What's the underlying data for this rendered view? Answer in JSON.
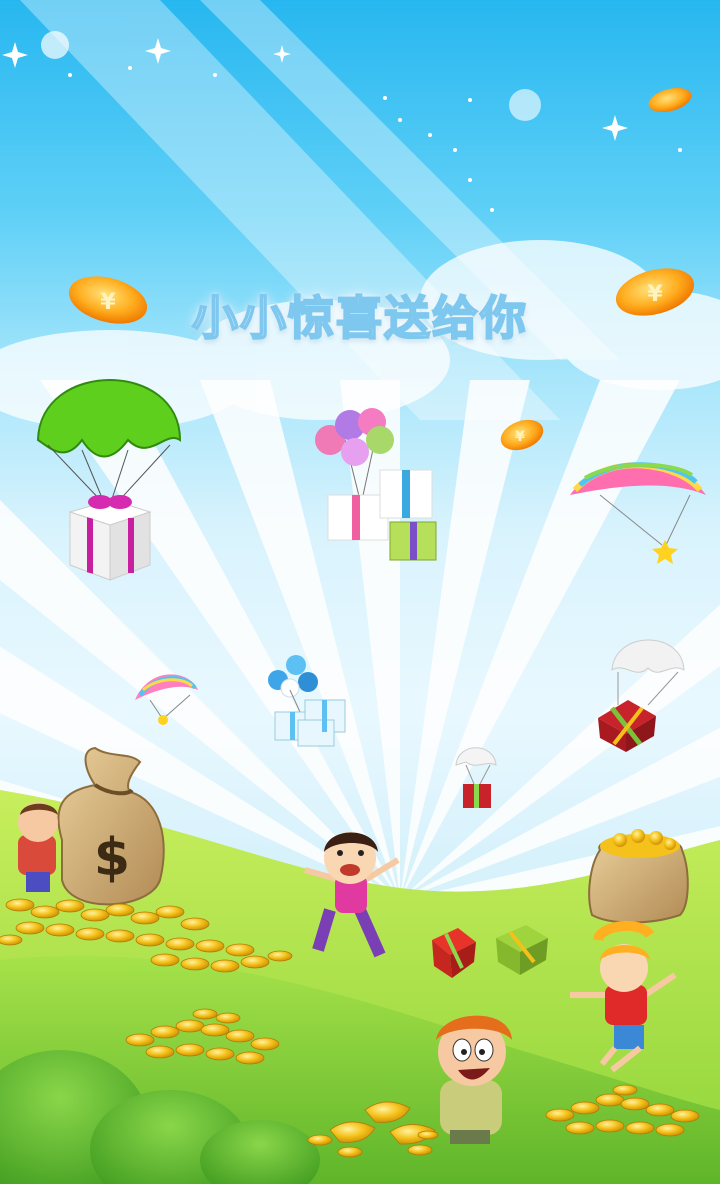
{
  "banner": {
    "title": "小小惊喜送给你"
  },
  "icons": {
    "coin": "yen-coin-icon",
    "money_bag": "dollar-money-bag-icon",
    "gift": "gift-box-icon",
    "parachute": "parachute-icon",
    "balloon": "balloon-icon"
  },
  "money_bag": {
    "symbol": "$"
  },
  "coin_symbol": "¥",
  "colors": {
    "sky_top": "#27b7f0",
    "sky_bottom": "#e9f8ff",
    "grass": "#8fd43a",
    "gold": "#f5b316"
  }
}
